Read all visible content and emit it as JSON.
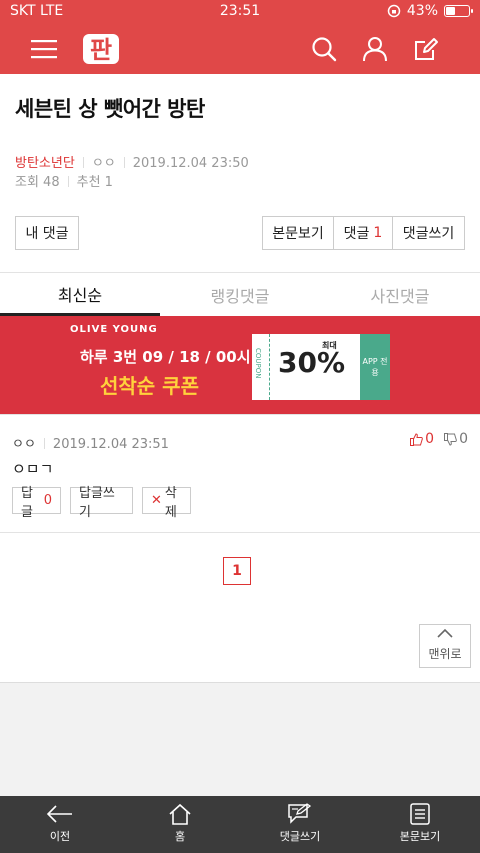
{
  "status_bar": {
    "carrier": "SKT LTE",
    "time": "23:51",
    "battery": "43%",
    "battery_level": 0.43
  },
  "header": {
    "logo_text": "판",
    "icons": [
      "menu-icon",
      "search-icon",
      "user-icon",
      "edit-icon"
    ]
  },
  "post": {
    "title": "세븐틴 상 뺏어간 방탄",
    "category": "방탄소년단",
    "author": "ㅇㅇ",
    "datetime": "2019.12.04 23:50",
    "views": "조회 48",
    "recommends": "추천 1"
  },
  "actions": {
    "my_comments": "내 댓글",
    "view_post": "본문보기",
    "comments_label": "댓글",
    "comments_count": "1",
    "write_comment": "댓글쓰기"
  },
  "tabs": [
    {
      "label": "최신순",
      "active": true
    },
    {
      "label": "랭킹댓글",
      "active": false
    },
    {
      "label": "사진댓글",
      "active": false
    }
  ],
  "banner": {
    "brand": "OLIVE YOUNG",
    "line1": "하루 3번 09 / 18 / 00시 !",
    "line2": "선착순 쿠폰",
    "coupon_word": "COUPON",
    "coupon_max": "최대",
    "coupon_percent": "30%",
    "coupon_app": "APP 전용"
  },
  "comment": {
    "author": "ㅇㅇ",
    "datetime": "2019.12.04 23:51",
    "likes": "0",
    "dislikes": "0",
    "body": "ㅇㅁㄱ",
    "reply_label": "답글",
    "reply_count": "0",
    "write_reply": "답글쓰기",
    "delete": "삭제"
  },
  "pagination": {
    "current": "1"
  },
  "to_top": "맨위로",
  "bottom_nav": [
    {
      "label": "이전",
      "icon": "back-arrow-icon"
    },
    {
      "label": "홈",
      "icon": "home-icon"
    },
    {
      "label": "댓글쓰기",
      "icon": "comment-write-icon"
    },
    {
      "label": "본문보기",
      "icon": "document-icon"
    }
  ],
  "colors": {
    "brand_red": "#e04848",
    "accent_red": "#dd3333",
    "nav_dark": "#3b3b3b",
    "banner_red": "#d9333f",
    "coupon_green": "#4aa98b"
  }
}
